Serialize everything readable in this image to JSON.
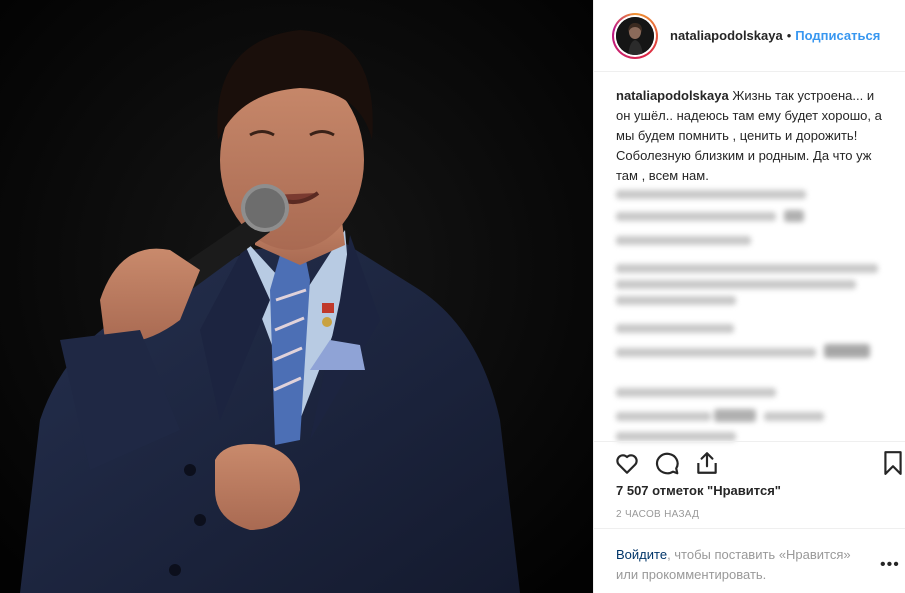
{
  "post": {
    "photo_alt": "",
    "header": {
      "username": "nataliapodolskaya",
      "dot": "•",
      "follow_label": "Подписаться"
    },
    "caption": {
      "username": "nataliapodolskaya",
      "text": "Жизнь так устроена... и он ушёл.. надеюсь там ему будет хорошо, а мы будем помнить , ценить и дорожить! Соболезную близким и родным. Да что уж там , всем нам."
    },
    "actions": {
      "like_icon": "heart-icon",
      "comment_icon": "comment-icon",
      "share_icon": "share-icon",
      "save_icon": "bookmark-icon"
    },
    "likes_text": "7 507 отметок \"Нравится\"",
    "time_text": "2 часов назад",
    "login_prompt": {
      "link": "Войдите",
      "rest": ", чтобы поставить «Нравится» или прокомментировать."
    },
    "more_label": "•••"
  },
  "colors": {
    "link_blue": "#3897f0",
    "dark_link": "#003569",
    "muted": "#999999",
    "border": "#efefef"
  }
}
